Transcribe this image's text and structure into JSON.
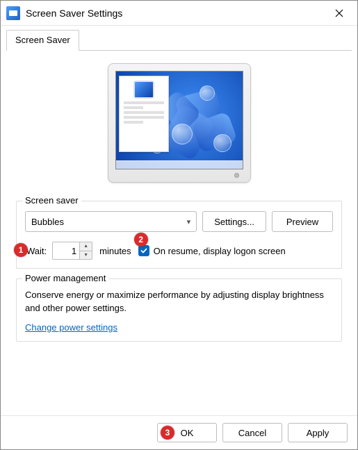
{
  "window": {
    "title": "Screen Saver Settings"
  },
  "tab": {
    "label": "Screen Saver"
  },
  "screensaver": {
    "group_label": "Screen saver",
    "selected": "Bubbles",
    "settings_btn": "Settings...",
    "preview_btn": "Preview",
    "wait_label": "Wait:",
    "wait_value": "1",
    "minutes_label": "minutes",
    "resume_checked": true,
    "resume_label": "On resume, display logon screen"
  },
  "power": {
    "group_label": "Power management",
    "text": "Conserve energy or maximize performance by adjusting display brightness and other power settings.",
    "link": "Change power settings"
  },
  "footer": {
    "ok": "OK",
    "cancel": "Cancel",
    "apply": "Apply"
  },
  "callouts": {
    "c1": "1",
    "c2": "2",
    "c3": "3"
  }
}
